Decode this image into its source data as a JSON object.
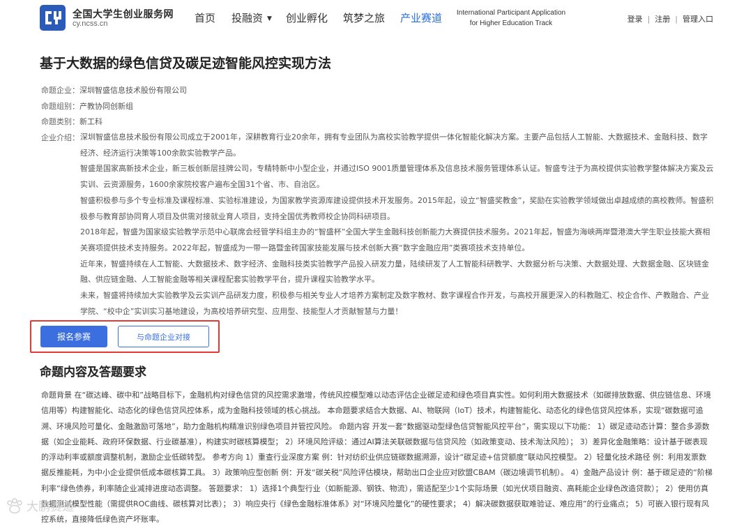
{
  "header": {
    "site_name": "全国大学生创业服务网",
    "site_domain": "cy.ncss.cn",
    "logo_icon": "cy-logo-icon",
    "nav": [
      {
        "label": "首页",
        "active": false
      },
      {
        "label": "投融资",
        "active": false,
        "dropdown": true
      },
      {
        "label": "创业孵化",
        "active": false
      },
      {
        "label": "筑梦之旅",
        "active": false
      },
      {
        "label": "产业赛道",
        "active": true
      }
    ],
    "intl_line1": "International Participant Application",
    "intl_line2": "for Higher Education Track",
    "login": "登录",
    "register": "注册",
    "admin": "管理入口"
  },
  "main": {
    "title": "基于大数据的绿色信贷及碳足迹智能风控实现方法",
    "meta": {
      "company_label": "命题企业：",
      "company": "深圳智盛信息技术股份有限公司",
      "group_label": "命题组别：",
      "group": "产教协同创新组",
      "category_label": "命题类别：",
      "category": "新工科"
    },
    "intro_label": "企业介绍：",
    "intro_paragraphs": [
      "深圳智盛信息技术股份有限公司成立于2001年，深耕教育行业20余年，拥有专业团队为高校实验教学提供一体化智能化解决方案。主要产品包括人工智能、大数据技术、金融科技、数字经济、经济运行决策等100余款实验教学产品。",
      "智盛是国家高新技术企业，新三板创新层挂牌公司，专精特新中小型企业，并通过ISO 9001质量管理体系及信息技术服务管理体系认证。智盛专注于为高校提供实验教学整体解决方案及云实训、云资源服务，1600余家院校客户遍布全国31个省、市、自治区。",
      "智盛积极参与多个专业标准及课程标准、实验标准建设，为国家教学资源库建设提供技术开发服务。2015年起，设立“智盛奖教金”，奖励在实验教学领域做出卓越成绩的高校教师。智盛积极参与教育部协同育人项目及供需对接就业育人项目，支持全国优秀教师校企协同科研项目。",
      "2018年起，智盛为国家级实验教学示范中心联席会经管学科组主办的“智盛杯”全国大学生金融科技创新能力大赛提供技术服务。2021年起，智盛为海峡两岸暨港澳大学生职业技能大赛相关赛项提供技术支持服务。2022年起，智盛成为一带一路暨金砖国家技能发展与技术创新大赛“数字金融应用”类赛项技术支持单位。",
      "近年来，智盛持续在人工智能、大数据技术、数字经济、金融科技类实验教学产品投入研发力量，陆续研发了人工智能科研教学、大数据分析与决策、大数据处理、大数据金融、区块链金融、供应链金融、人工智能金融等相关课程配套实验教学平台，提升课程实验教学水平。",
      "未来，智盛将持续加大实验教学及云实训产品研发力度，积极参与相关专业人才培养方案制定及数字教材、数字课程合作开发，与高校开展更深入的科教融汇、校企合作、产教融合、产业学院、“校中企”实训实习基地建设，为高校培养研究型、应用型、技能型人才贡献智慧与力量！"
    ],
    "btn_register": "报名参赛",
    "btn_connect": "与命题企业对接",
    "section_title": "命题内容及答题要求",
    "section_body": "命题背景 在“碳达峰、碳中和”战略目标下，金融机构对绿色信贷的风控需求激增，传统风控模型难以动态评估企业碳足迹和绿色项目真实性。如何利用大数据技术（如碳排放数据、供应链信息、环境信用等）构建智能化、动态化的绿色信贷风控体系，成为金融科技领域的核心挑战。 本命题要求结合大数据、AI、物联网（IoT）技术，构建智能化、动态化的绿色信贷风控体系，实现“碳数据可追溯、环境风险可量化、金融激励可落地”，助力金融机构精准识别绿色项目并管控风险。 命题内容 开发一套“数据驱动型绿色信贷智能风控平台”，需实现以下功能： 1）碳足迹动态计算：整合多源数据（如企业能耗、政府环保数据、行业碳基准），构建实时碳核算模型； 2）环境风险评级：通过AI算法关联碳数据与信贷风险（如政策变动、技术淘汰风险）； 3）差异化金融策略：设计基于碳表现的浮动利率或额度调整机制，激励企业低碳转型。 参考方向 1）重查行业深度方案 例：针对纺织业供应链碳数据溯源，设计“碳足迹+信贷额度”联动风控模型。 2）轻量化技术路径 例：利用发票数据反推能耗，为中小企业提供低成本碳核算工具。 3）政策响应型创新 例：开发“碳关税”风险评估模块，帮助出口企业应对欧盟CBAM（碳边境调节机制）。 4）金融产品设计 例：基于碳足迹的“阶梯利率”绿色债券，利率随企业减排进度动态调整。 答题要求： 1）选择1个典型行业（如新能源、钢铁、物流），需适配至少1个实际场景（如光伏项目融资、高耗能企业绿色改造贷款）； 2）使用仿真数据测试模型性能（需提供ROC曲线、碳核算对比表）； 3）响应央行《绿色金融标准体系》对“环境风险量化”的硬性要求； 4）解决碳数据获取难验证、难应用”的行业痛点； 5）可嵌入银行现有风控系统，直接降低绿色资产坏账率。"
  },
  "watermark": {
    "text": "大鹏赛道",
    "icon": "paw-logo-icon"
  },
  "colors": {
    "accent": "#2b6fd6",
    "button_primary": "#3b6fe0",
    "highlight_frame": "#e53935"
  }
}
